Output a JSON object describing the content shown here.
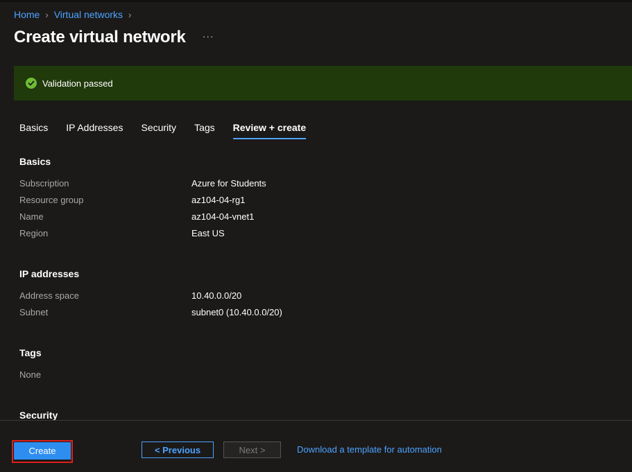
{
  "breadcrumb": {
    "home": "Home",
    "virtual_networks": "Virtual networks"
  },
  "page": {
    "title": "Create virtual network",
    "more": "···"
  },
  "banner": {
    "text": "Validation passed",
    "color": "#203a0b",
    "icon": "check-circle-icon"
  },
  "tabs": [
    {
      "label": "Basics"
    },
    {
      "label": "IP Addresses"
    },
    {
      "label": "Security"
    },
    {
      "label": "Tags"
    },
    {
      "label": "Review + create",
      "active": true
    }
  ],
  "sections": {
    "basics": {
      "title": "Basics",
      "rows": [
        {
          "label": "Subscription",
          "value": "Azure for Students"
        },
        {
          "label": "Resource group",
          "value": "az104-04-rg1"
        },
        {
          "label": "Name",
          "value": "az104-04-vnet1"
        },
        {
          "label": "Region",
          "value": "East US"
        }
      ]
    },
    "ip": {
      "title": "IP addresses",
      "rows": [
        {
          "label": "Address space",
          "value": "10.40.0.0/20"
        },
        {
          "label": "Subnet",
          "value": "subnet0 (10.40.0.0/20)"
        }
      ]
    },
    "tags": {
      "title": "Tags",
      "rows": [
        {
          "label": "None",
          "value": ""
        }
      ]
    },
    "security": {
      "title": "Security"
    }
  },
  "footer": {
    "create_label": "Create",
    "previous_label": "< Previous",
    "next_label": "Next >",
    "download_label": "Download a template for automation"
  },
  "colors": {
    "accent": "#4da3ff",
    "primary_button": "#2e8ef0",
    "highlight_border": "#e0201c"
  }
}
